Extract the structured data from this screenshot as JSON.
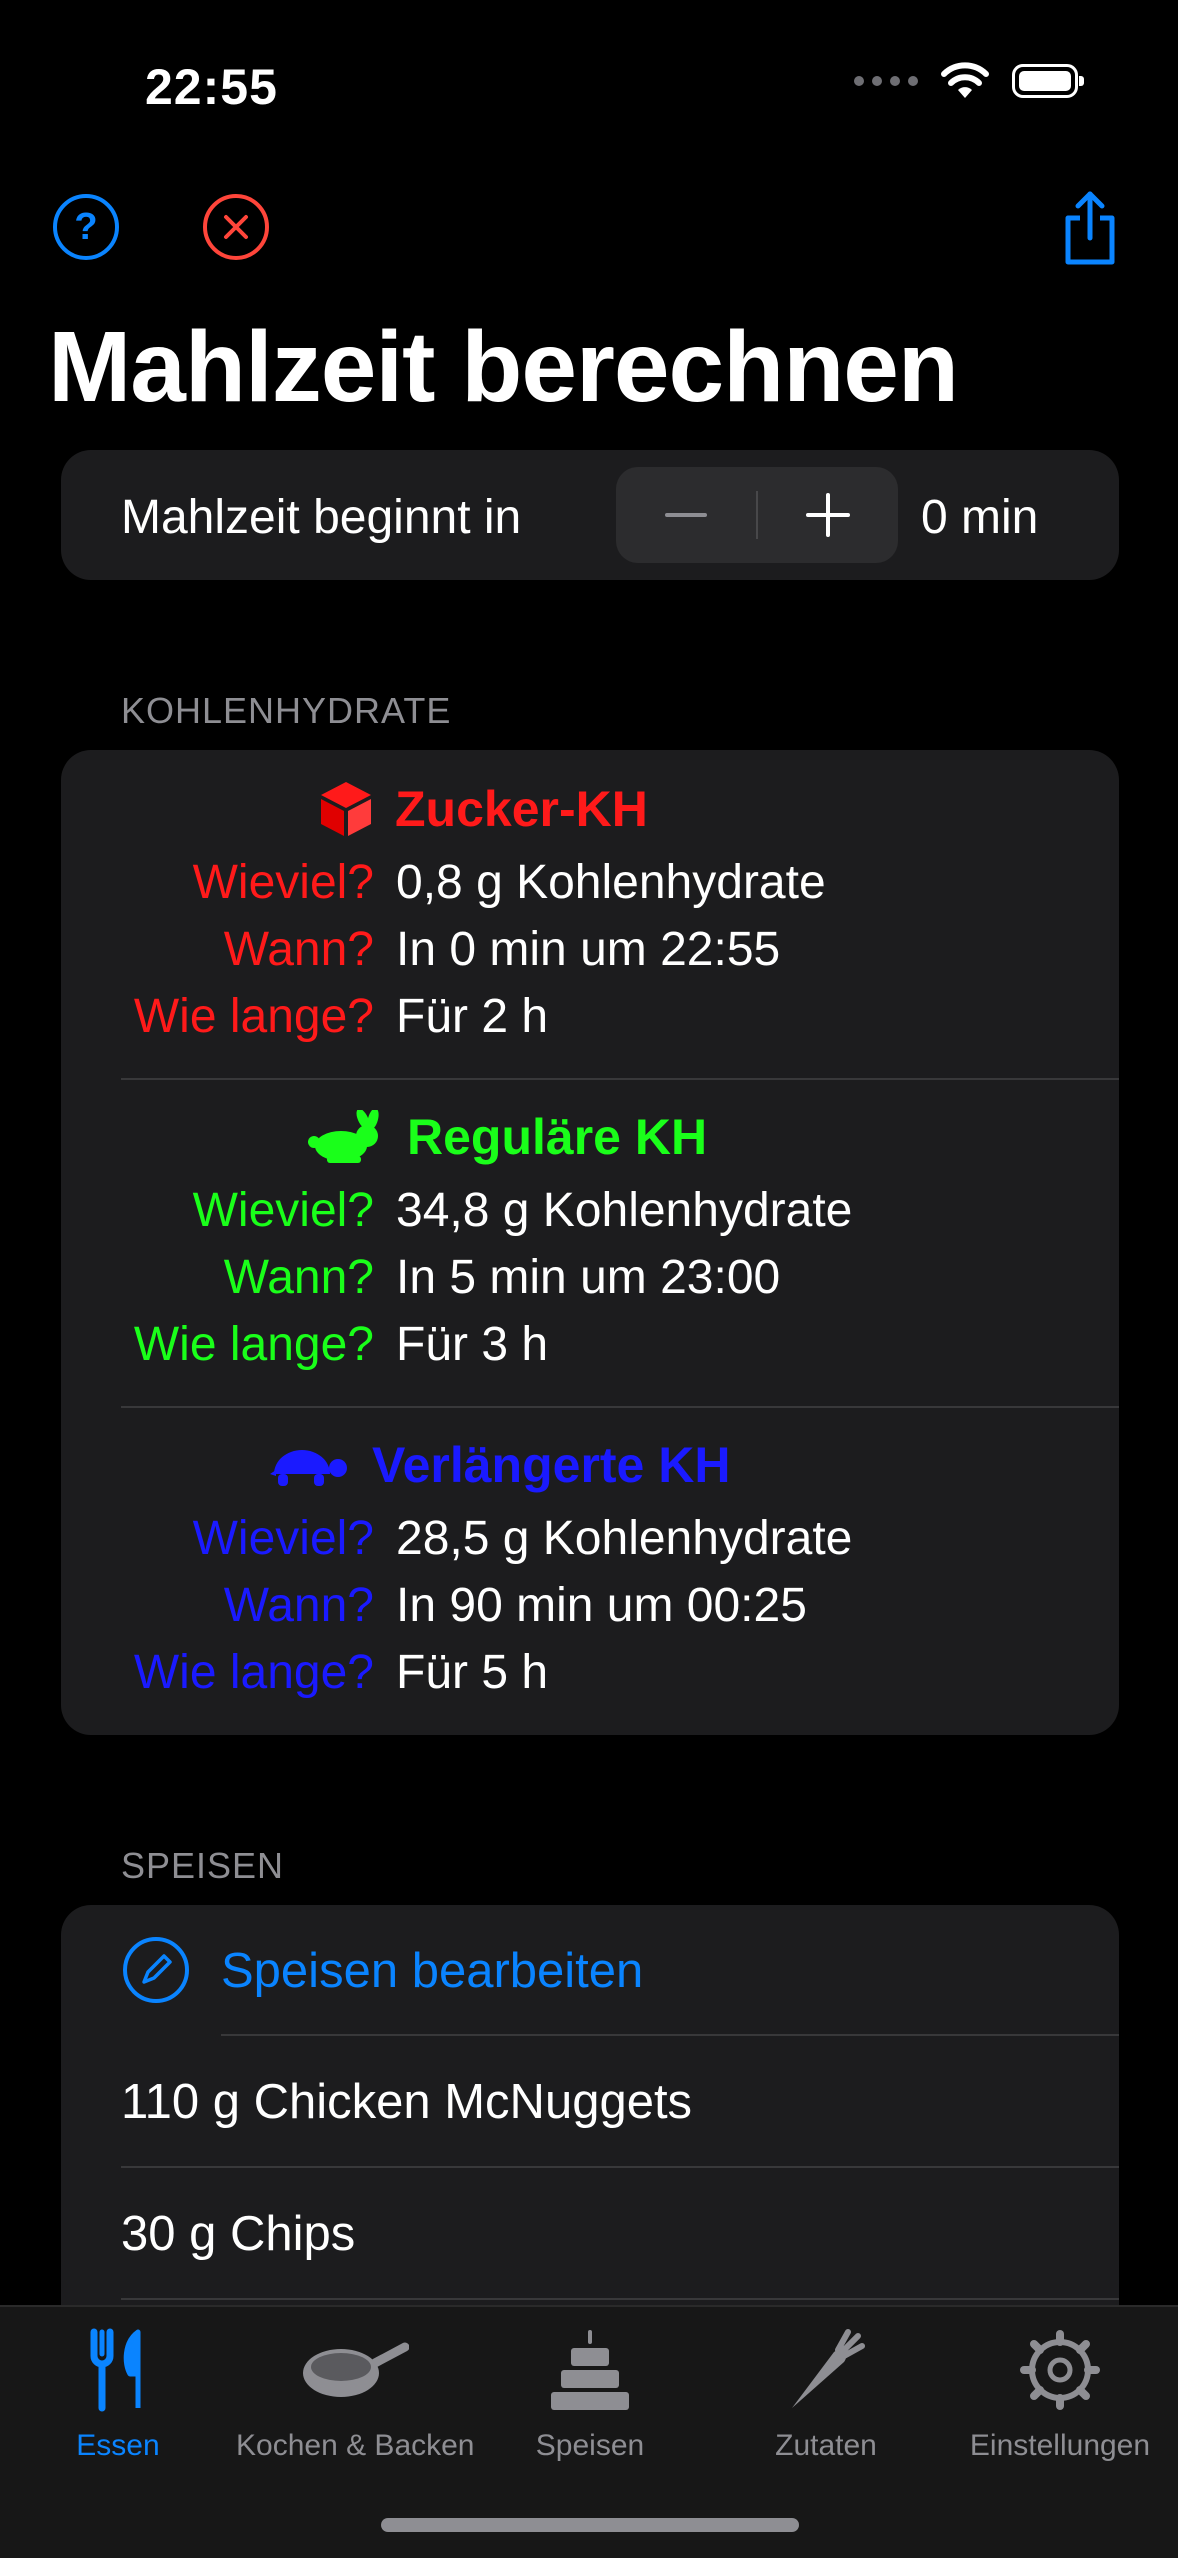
{
  "status_bar": {
    "time": "22:55"
  },
  "nav": {
    "title": "Mahlzeit berechnen"
  },
  "start": {
    "label": "Mahlzeit beginnt in",
    "value": "0  min"
  },
  "carbs": {
    "header": "KOHLENHYDRATE",
    "blocks": [
      {
        "title": "Zucker-KH",
        "color": "#ff1a1a",
        "icon": "cube-icon",
        "wieviel_label": "Wieviel?",
        "wieviel": "0,8  g Kohlenhydrate",
        "wann_label": "Wann?",
        "wann": "In  0  min um  22:55",
        "wielange_label": "Wie lange?",
        "wielange": "Für  2  h"
      },
      {
        "title": "Reguläre KH",
        "color": "#1aff1a",
        "icon": "rabbit-icon",
        "wieviel_label": "Wieviel?",
        "wieviel": "34,8  g Kohlenhydrate",
        "wann_label": "Wann?",
        "wann": "In  5  min um  23:00",
        "wielange_label": "Wie lange?",
        "wielange": "Für  3  h"
      },
      {
        "title": "Verlängerte KH",
        "color": "#1a1aff",
        "icon": "tortoise-icon",
        "wieviel_label": "Wieviel?",
        "wieviel": "28,5  g Kohlenhydrate",
        "wann_label": "Wann?",
        "wann": "In  90  min um  00:25",
        "wielange_label": "Wie lange?",
        "wielange": "Für  5  h"
      }
    ]
  },
  "speisen": {
    "header": "SPEISEN",
    "edit_label": "Speisen bearbeiten",
    "items": [
      "110  g  Chicken McNuggets",
      "30  g  Chips"
    ]
  },
  "tabs": [
    {
      "label": "Essen",
      "icon": "fork-knife-icon",
      "active": true
    },
    {
      "label": "Kochen & Backen",
      "icon": "frying-pan-icon",
      "active": false
    },
    {
      "label": "Speisen",
      "icon": "cake-icon",
      "active": false
    },
    {
      "label": "Zutaten",
      "icon": "carrot-icon",
      "active": false
    },
    {
      "label": "Einstellungen",
      "icon": "gear-icon",
      "active": false
    }
  ],
  "colors": {
    "accent": "#0a84ff",
    "destructive": "#ff453a",
    "card": "#1c1c1e"
  }
}
